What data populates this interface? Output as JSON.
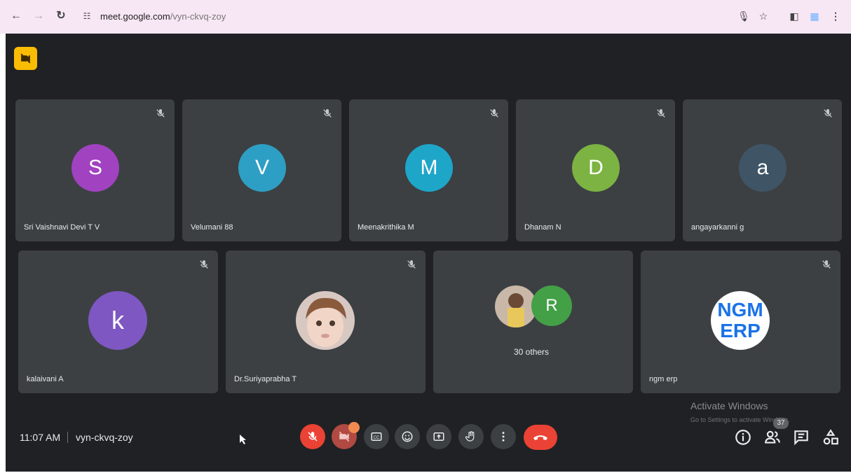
{
  "browser": {
    "url_host": "meet.google.com",
    "url_path": "/vyn-ckvq-zoy"
  },
  "participants_row1": [
    {
      "name": "Sri Vaishnavi Devi T V",
      "initial": "S",
      "color": "#a142c0"
    },
    {
      "name": "Velumani 88",
      "initial": "V",
      "color": "#2e9fc4"
    },
    {
      "name": "Meenakrithika M",
      "initial": "M",
      "color": "#1ea6c9"
    },
    {
      "name": "Dhanam N",
      "initial": "D",
      "color": "#7cb342"
    },
    {
      "name": "angayarkanni g",
      "initial": "a",
      "color": "#3f5566"
    }
  ],
  "participants_row2": [
    {
      "name": "kalaivani A",
      "initial": "k",
      "color": "#7e57c2"
    },
    {
      "name": "Dr.Suriyaprabha T"
    },
    {
      "others_label": "30 others",
      "initial": "R",
      "color": "#43a047"
    },
    {
      "name": "ngm erp",
      "logo_line1": "NGM",
      "logo_line2": "ERP"
    }
  ],
  "watermark": {
    "title": "Activate Windows",
    "subtitle": "Go to Settings to activate Windows."
  },
  "meeting": {
    "time": "11:07 AM",
    "code": "vyn-ckvq-zoy"
  },
  "participants_count": "37",
  "colors": {
    "stage": "#202124",
    "tile": "#3c4043",
    "danger": "#ea4335",
    "badge": "#fbbc04"
  },
  "icons": [
    "camera-off-icon",
    "mic-off-icon",
    "captions-icon",
    "emoji-icon",
    "present-icon",
    "raise-hand-icon",
    "more-options-icon",
    "end-call-icon",
    "info-icon",
    "people-icon",
    "chat-icon",
    "activities-icon"
  ]
}
